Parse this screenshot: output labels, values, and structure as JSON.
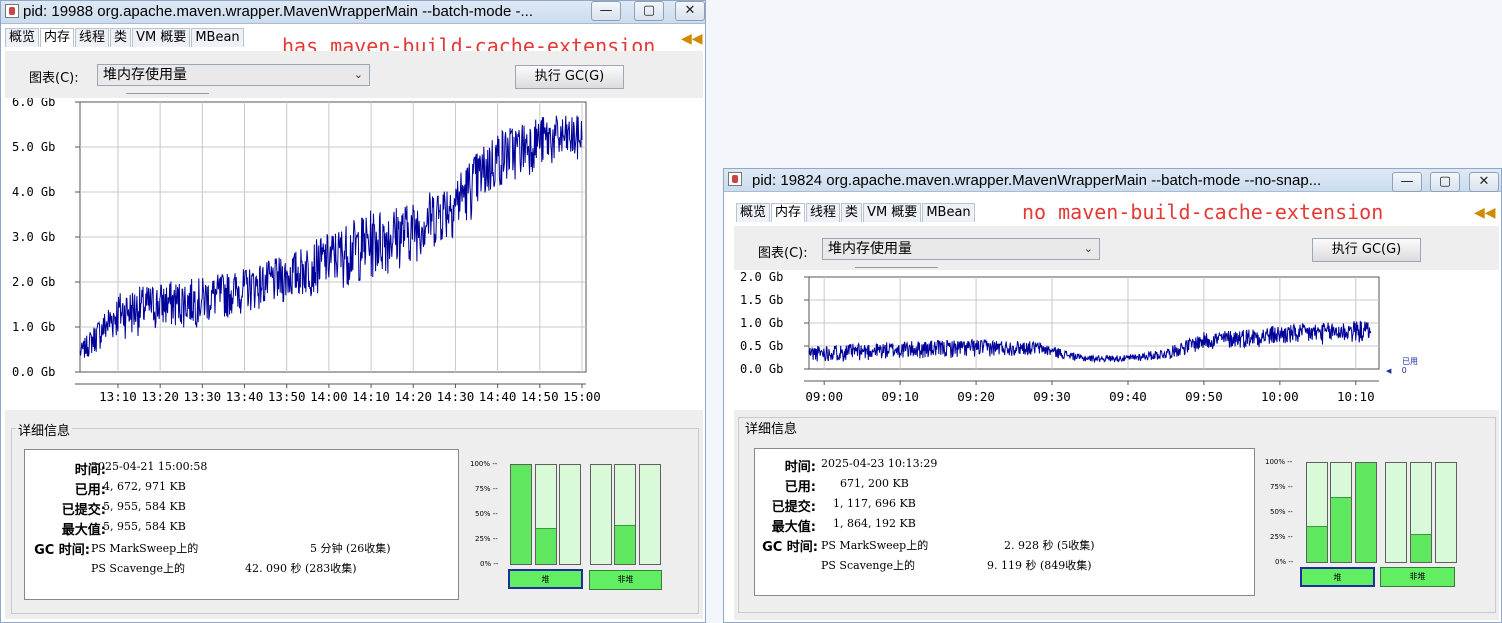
{
  "window1": {
    "title": "pid: 19988 org.apache.maven.wrapper.MavenWrapperMain --batch-mode -...",
    "tabs": [
      "概览",
      "内存",
      "线程",
      "类",
      "VM 概要",
      "MBean"
    ],
    "annotation": "has maven-build-cache-extension",
    "chart_label": "图表(C):",
    "chart_select": "堆内存使用量",
    "gc_button": "执行 GC(G)",
    "details_title": "详细信息",
    "info": {
      "time_key": "时间:",
      "time": "2025-04-21 15:00:58",
      "used_key": "已用:",
      "used": "4, 672, 971 KB",
      "committed_key": "已提交:",
      "committed": "5, 955, 584 KB",
      "max_key": "最大值:",
      "max": "5, 955, 584 KB",
      "gc_key": "GC 时间:",
      "gc1_name": "PS MarkSweep上的",
      "gc1_value": "5 分钟 (26收集)",
      "gc2_name": "PS Scavenge上的",
      "gc2_value": "42. 090 秒 (283收集)"
    },
    "pct_labels": [
      "100% --",
      "75% --",
      "50% --",
      "25% --",
      "0% --"
    ],
    "heap_bar_levels": [
      100,
      35,
      0
    ],
    "nonheap_bar_levels": [
      0,
      38,
      0
    ],
    "heap_button": "堆",
    "nonheap_button": "非堆"
  },
  "window2": {
    "title": "pid: 19824 org.apache.maven.wrapper.MavenWrapperMain --batch-mode --no-snap...",
    "tabs": [
      "概览",
      "内存",
      "线程",
      "类",
      "VM 概要",
      "MBean"
    ],
    "annotation": "no maven-build-cache-extension",
    "chart_label": "图表(C):",
    "chart_select": "堆内存使用量",
    "gc_button": "执行 GC(G)",
    "details_title": "详细信息",
    "legend_label": "已用",
    "legend_value": "0",
    "info": {
      "time_key": "时间:",
      "time": "2025-04-23 10:13:29",
      "used_key": "已用:",
      "used": "671, 200 KB",
      "committed_key": "已提交:",
      "committed": "1, 117, 696 KB",
      "max_key": "最大值:",
      "max": "1, 864, 192 KB",
      "gc_key": "GC 时间:",
      "gc1_name": "PS MarkSweep上的",
      "gc1_value": "2. 928 秒 (5收集)",
      "gc2_name": "PS Scavenge上的",
      "gc2_value": "9. 119 秒 (849收集)"
    },
    "pct_labels": [
      "100% --",
      "75% --",
      "50% --",
      "25% --",
      "0% --"
    ],
    "heap_bar_levels": [
      35,
      65,
      100
    ],
    "nonheap_bar_levels": [
      0,
      27,
      0
    ],
    "heap_button": "堆",
    "nonheap_button": "非堆"
  },
  "titlebar_buttons": {
    "minimize": "—",
    "maximize": "▢",
    "close": "✕"
  },
  "chart_data": [
    {
      "type": "line",
      "title": "",
      "ylabel": "",
      "y_ticks": [
        "6.0 Gb",
        "5.0 Gb",
        "4.0 Gb",
        "3.0 Gb",
        "2.0 Gb",
        "1.0 Gb",
        "0.0 Gb"
      ],
      "x_ticks": [
        "13:10",
        "13:20",
        "13:30",
        "13:40",
        "13:50",
        "14:00",
        "14:10",
        "14:20",
        "14:30",
        "14:40",
        "14:50",
        "15:00"
      ],
      "ylim": [
        0,
        6.0
      ],
      "y_unit": "Gb",
      "series_color": "#00009a",
      "trend": {
        "times": [
          "13:01",
          "13:10",
          "13:20",
          "13:30",
          "13:40",
          "13:50",
          "14:00",
          "14:10",
          "14:20",
          "14:30",
          "14:40",
          "14:50",
          "15:00"
        ],
        "low": [
          0.2,
          0.7,
          0.9,
          1.0,
          1.3,
          1.5,
          1.8,
          2.0,
          2.4,
          3.0,
          4.0,
          4.5,
          4.6
        ],
        "high": [
          0.6,
          1.8,
          2.0,
          2.1,
          2.3,
          2.6,
          3.1,
          3.6,
          3.8,
          4.4,
          5.4,
          5.7,
          5.7
        ]
      },
      "grid": true
    },
    {
      "type": "line",
      "title": "",
      "ylabel": "",
      "y_ticks": [
        "2.0 Gb",
        "1.5 Gb",
        "1.0 Gb",
        "0.5 Gb",
        "0.0 Gb"
      ],
      "x_ticks": [
        "09:00",
        "09:10",
        "09:20",
        "09:30",
        "09:40",
        "09:50",
        "10:00",
        "10:10"
      ],
      "ylim": [
        0,
        2.0
      ],
      "y_unit": "Gb",
      "series_color": "#00009a",
      "trend": {
        "times": [
          "08:58",
          "09:10",
          "09:20",
          "09:28",
          "09:34",
          "09:40",
          "09:45",
          "09:50",
          "10:00",
          "10:10",
          "10:12"
        ],
        "low": [
          0.15,
          0.2,
          0.25,
          0.3,
          0.15,
          0.15,
          0.2,
          0.4,
          0.5,
          0.55,
          0.6
        ],
        "high": [
          0.5,
          0.6,
          0.65,
          0.6,
          0.3,
          0.3,
          0.45,
          0.8,
          0.95,
          1.05,
          1.05
        ]
      },
      "grid": true
    }
  ]
}
